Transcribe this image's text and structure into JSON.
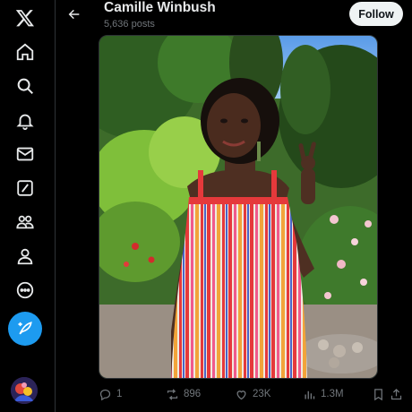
{
  "header": {
    "title": "Camille Winbush",
    "subtitle": "5,636 posts",
    "follow_label": "Follow"
  },
  "sidebar": {
    "items": [
      {
        "icon": "x-logo-icon"
      },
      {
        "icon": "home-icon"
      },
      {
        "icon": "search-icon"
      },
      {
        "icon": "bell-icon"
      },
      {
        "icon": "mail-icon"
      },
      {
        "icon": "grok-icon"
      },
      {
        "icon": "communities-icon"
      },
      {
        "icon": "profile-icon"
      },
      {
        "icon": "more-icon"
      }
    ],
    "compose_icon": "compose-feather-icon"
  },
  "post": {
    "stats": {
      "replies": "1",
      "reposts": "896",
      "likes": "23K",
      "views": "1.3M"
    }
  },
  "colors": {
    "accent": "#1d9bf0",
    "background": "#000000",
    "text_secondary": "#71767b"
  }
}
